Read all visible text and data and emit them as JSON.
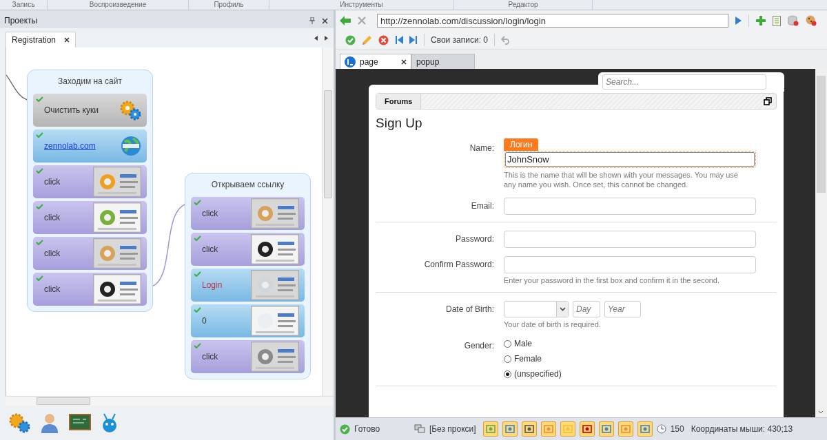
{
  "ribbon_groups": [
    "Запись",
    "Воспроизведение",
    "Профиль",
    "Инструменты",
    "Редактор"
  ],
  "projects_panel": {
    "title": "Проекты",
    "tabs": [
      {
        "label": "Registration",
        "selected": true
      }
    ],
    "groups": [
      {
        "title": "Заходим на сайт",
        "nodes": [
          {
            "kind": "action",
            "label": "Очистить куки",
            "done": true
          },
          {
            "kind": "navigate",
            "label": "zennolab.com",
            "done": true
          },
          {
            "kind": "click",
            "label": "click",
            "done": true
          },
          {
            "kind": "click",
            "label": "click",
            "done": true
          },
          {
            "kind": "click",
            "label": "click",
            "done": true
          },
          {
            "kind": "click",
            "label": "click",
            "done": true
          }
        ]
      },
      {
        "title": "Открываем ссылку",
        "nodes": [
          {
            "kind": "click",
            "label": "click",
            "done": true
          },
          {
            "kind": "click",
            "label": "click",
            "done": true
          },
          {
            "kind": "input",
            "label": "Login",
            "done": true,
            "variable": true
          },
          {
            "kind": "input",
            "label": "0",
            "done": true
          },
          {
            "kind": "click",
            "label": "click",
            "done": true
          }
        ]
      }
    ]
  },
  "browser": {
    "url": "http://zennolab.com/discussion/login/login",
    "records": "Свои записи: 0",
    "tabs": [
      {
        "label": "page",
        "selected": true
      },
      {
        "label": "popup",
        "selected": false
      }
    ],
    "page": {
      "search_placeholder": "Search...",
      "breadcrumb": "Forums",
      "heading": "Sign Up",
      "sections": [
        [
          {
            "kind": "text",
            "label": "Name:",
            "value": "JohnSnow",
            "tag": "Логин",
            "focused": true,
            "hint": "This is the name that will be shown with your messages. You may use any name you wish. Once set, this cannot be changed."
          },
          {
            "kind": "text",
            "label": "Email:",
            "focused": false
          }
        ],
        [
          {
            "kind": "text",
            "label": "Password:",
            "focused": false
          },
          {
            "kind": "text",
            "label": "Confirm Password:",
            "focused": false,
            "hint": "Enter your password in the first box and confirm it in the second."
          }
        ],
        [
          {
            "kind": "date",
            "label": "Date of Birth:",
            "day_placeholder": "Day",
            "year_placeholder": "Year",
            "hint": "Your date of birth is required."
          },
          {
            "kind": "radio",
            "label": "Gender:",
            "options": [
              {
                "label": "Male",
                "selected": false
              },
              {
                "label": "Female",
                "selected": false
              },
              {
                "label": "(unspecified)",
                "selected": true
              }
            ]
          }
        ]
      ]
    }
  },
  "status_bar": {
    "state": "Готово",
    "proxy": "[Без прокси]",
    "threads": "150",
    "mouse": "Координаты мыши: 430;13"
  }
}
